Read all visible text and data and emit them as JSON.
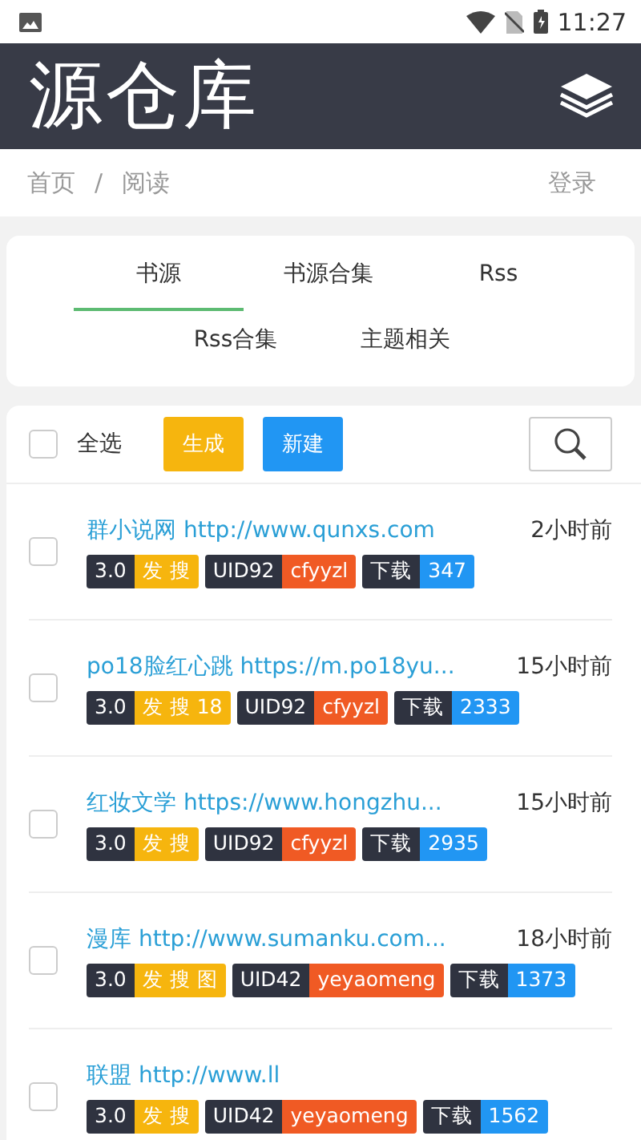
{
  "status_bar": {
    "time": "11:27"
  },
  "header": {
    "title": "源仓库"
  },
  "breadcrumb": {
    "items": [
      "首页",
      "阅读"
    ],
    "separator": "/",
    "login": "登录"
  },
  "tabs": [
    {
      "label": "书源",
      "selected": true
    },
    {
      "label": "书源合集",
      "selected": false
    },
    {
      "label": "Rss",
      "selected": false
    },
    {
      "label": "Rss合集",
      "selected": false
    },
    {
      "label": "主题相关",
      "selected": false
    }
  ],
  "toolbar": {
    "select_all": {
      "label": "全选",
      "checked": false
    },
    "buttons": [
      {
        "label": "生成",
        "kind": "warning"
      },
      {
        "label": "新建",
        "kind": "primary"
      }
    ]
  },
  "sources": [
    {
      "title": "群小说网 http://www.qunxs.com",
      "time": "2小时前",
      "checked": false,
      "version": "3.0",
      "tags": "发 搜",
      "uid": "UID92",
      "author": "cfyyzl",
      "download_label": "下载",
      "downloads": "347"
    },
    {
      "title": "po18脸红心跳 https://m.po18yu...",
      "time": "15小时前",
      "checked": false,
      "version": "3.0",
      "tags": "发 搜 18",
      "uid": "UID92",
      "author": "cfyyzl",
      "download_label": "下载",
      "downloads": "2333"
    },
    {
      "title": "红妆文学 https://www.hongzhu...",
      "time": "15小时前",
      "checked": false,
      "version": "3.0",
      "tags": "发 搜",
      "uid": "UID92",
      "author": "cfyyzl",
      "download_label": "下载",
      "downloads": "2935"
    },
    {
      "title": "漫库 http://www.sumanku.com...",
      "time": "18小时前",
      "checked": false,
      "version": "3.0",
      "tags": "发 搜 图",
      "uid": "UID42",
      "author": "yeyaomeng",
      "download_label": "下载",
      "downloads": "1373"
    },
    {
      "title": "联盟 http://www.ll",
      "checked": false,
      "version": "3.0",
      "tags": "发 搜",
      "uid": "UID42",
      "author": "yeyaomeng",
      "download_label": "下载",
      "downloads": "1562"
    }
  ]
}
